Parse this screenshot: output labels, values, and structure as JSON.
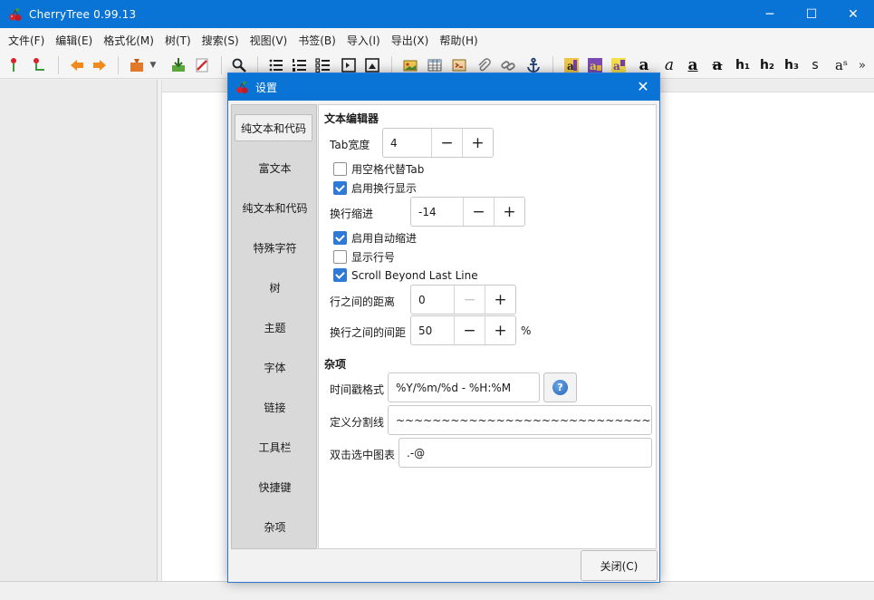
{
  "window": {
    "title": "CherryTree 0.99.13",
    "minimize_glyph": "─",
    "maximize_glyph": "☐",
    "close_glyph": "✕"
  },
  "menu": [
    "文件(F)",
    "编辑(E)",
    "格式化(M)",
    "树(T)",
    "搜索(S)",
    "视图(V)",
    "书签(B)",
    "导入(I)",
    "导出(X)",
    "帮助(H)"
  ],
  "toolbar_text": {
    "bold": "a",
    "italic": "a",
    "underline": "a",
    "strike": "a",
    "h1": "h₁",
    "h2": "h₂",
    "h3": "h₃",
    "small": "s",
    "superscript": "aˢ",
    "more": "»"
  },
  "dialog": {
    "title": "设置",
    "close_glyph": "✕",
    "sidebar": [
      "纯文本和代码",
      "富文本",
      "纯文本和代码",
      "特殊字符",
      "树",
      "主题",
      "字体",
      "链接",
      "工具栏",
      "快捷键",
      "杂项"
    ],
    "section_editor": "文本编辑器",
    "tab_width_label": "Tab宽度",
    "tab_width_value": "4",
    "spaces_instead_tab": "用空格代替Tab",
    "enable_wrap": "启用换行显示",
    "wrap_indent_label": "换行缩进",
    "wrap_indent_value": "-14",
    "auto_indent": "启用自动缩进",
    "show_line_numbers": "显示行号",
    "scroll_beyond": "Scroll Beyond Last Line",
    "line_spacing_label": "行之间的距离",
    "line_spacing_value": "0",
    "wrap_spacing_label": "换行之间的间距",
    "wrap_spacing_value": "50",
    "percent": "%",
    "section_misc": "杂项",
    "timestamp_label": "时间戳格式",
    "timestamp_value": "%Y/%m/%d - %H:%M",
    "help_glyph": "?",
    "divider_label": "定义分割线",
    "divider_value": "~~~~~~~~~~~~~~~~~~~~~~~~~~~~~~~~~~~~~~~~",
    "dblclick_label": "双击选中图表",
    "dblclick_value": ".-@",
    "minus": "−",
    "plus": "+",
    "close_button": "关闭(C)",
    "checks": {
      "spaces_instead_tab": false,
      "enable_wrap": true,
      "auto_indent": true,
      "show_line_numbers": false,
      "scroll_beyond": true
    }
  }
}
